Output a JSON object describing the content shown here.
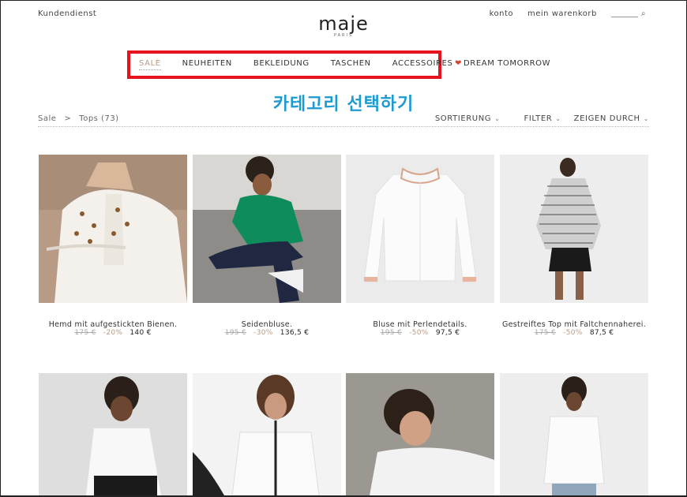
{
  "header": {
    "customer_service": "Kundendienst",
    "logo": "maje",
    "logo_sub": "PARIS",
    "account": "konto",
    "cart": "mein warenkorb"
  },
  "nav": {
    "items": [
      {
        "label": "SALE",
        "active": true
      },
      {
        "label": "NEUHEITEN"
      },
      {
        "label": "BEKLEIDUNG"
      },
      {
        "label": "TASCHEN"
      },
      {
        "label": "ACCESSOIRES"
      }
    ],
    "dream": "DREAM TOMORROW"
  },
  "annotation": "카테고리 선택하기",
  "breadcrumb": {
    "root": "Sale",
    "separator": ">",
    "current": "Tops (73)"
  },
  "filters": {
    "sort": "SORTIERUNG",
    "filter": "FILTER",
    "view": "ZEIGEN DURCH"
  },
  "products": [
    {
      "name": "Hemd mit aufgestickten Bienen.",
      "old_price": "175 €",
      "discount": "-20%",
      "price": "140 €"
    },
    {
      "name": "Seidenbluse.",
      "old_price": "195 €",
      "discount": "-30%",
      "price": "136,5 €"
    },
    {
      "name": "Bluse mit Perlendetails.",
      "old_price": "195 €",
      "discount": "-50%",
      "price": "97,5 €"
    },
    {
      "name": "Gestreiftes Top mit Faltchennaherei.",
      "old_price": "175 €",
      "discount": "-50%",
      "price": "87,5 €"
    },
    {
      "name": ""
    },
    {
      "name": ""
    },
    {
      "name": ""
    },
    {
      "name": ""
    }
  ],
  "colors": {
    "accent": "#b89b84",
    "highlight_box": "#e6121d",
    "annotation": "#1b9bd1"
  }
}
